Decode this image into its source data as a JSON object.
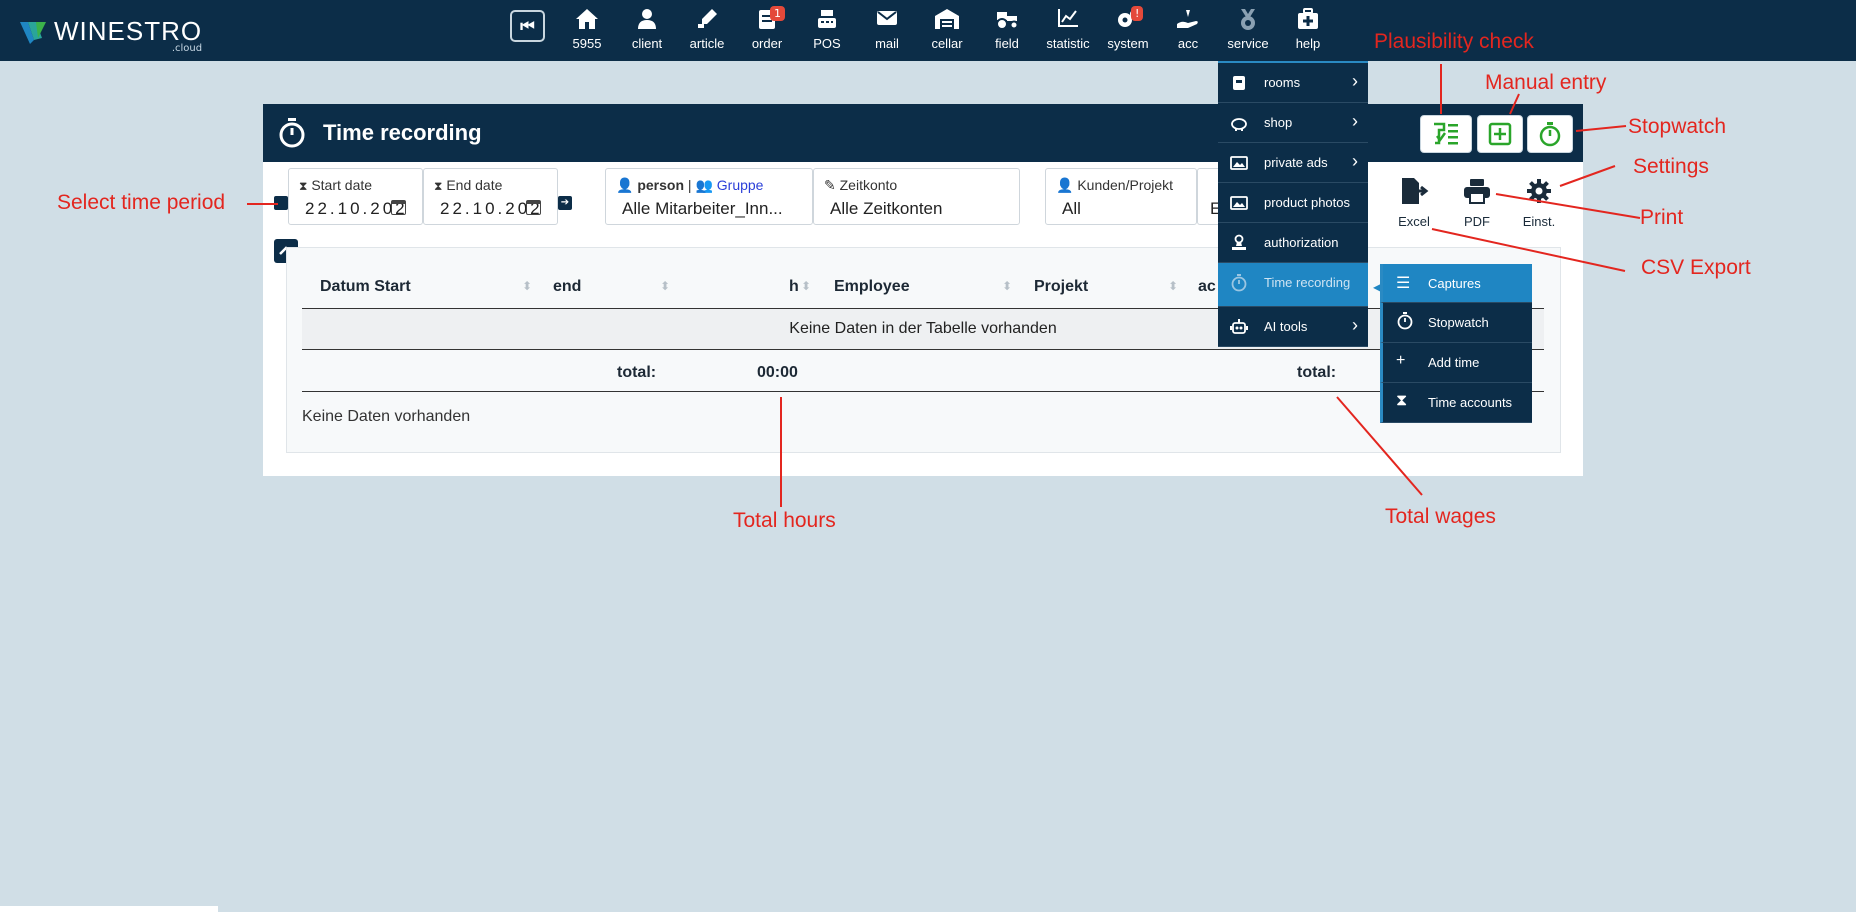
{
  "brand": {
    "name": "WINESTRO",
    "sub": ".cloud"
  },
  "nav": [
    {
      "label": "5955",
      "icon": "home-icon"
    },
    {
      "label": "client",
      "icon": "user-icon"
    },
    {
      "label": "article",
      "icon": "wine-icon"
    },
    {
      "label": "order",
      "icon": "order-icon",
      "badge": "1"
    },
    {
      "label": "POS",
      "icon": "register-icon"
    },
    {
      "label": "mail",
      "icon": "mail-icon"
    },
    {
      "label": "cellar",
      "icon": "warehouse-icon"
    },
    {
      "label": "field",
      "icon": "tractor-icon"
    },
    {
      "label": "statistic",
      "icon": "chart-icon"
    },
    {
      "label": "system",
      "icon": "gears-icon",
      "badge": "!"
    },
    {
      "label": "acc",
      "icon": "hand-coin-icon"
    },
    {
      "label": "service",
      "icon": "medal-icon"
    },
    {
      "label": "help",
      "icon": "first-aid-icon"
    }
  ],
  "panel": {
    "title": "Time recording",
    "start_label": "Start date",
    "start_value": "22.10.202",
    "end_label": "End date",
    "end_value": "22.10.202",
    "person_label": "person",
    "separator": "|",
    "group_label": "Gruppe",
    "person_value": "Alle Mitarbeiter_Inn...",
    "account_label": "Zeitkonto",
    "account_value": "Alle Zeitkonten",
    "client_label": "Kunden/Projekt",
    "client_value": "All",
    "extra_value": "E"
  },
  "tools": [
    {
      "label": "Excel"
    },
    {
      "label": "PDF"
    },
    {
      "label": "Einst."
    }
  ],
  "table": {
    "columns": [
      "Datum Start",
      "end",
      "h",
      "Employee",
      "Projekt",
      "ac"
    ],
    "empty_text": "Keine Daten in der Tabelle vorhanden",
    "total_label": "total:",
    "total_hours": "00:00",
    "total_label2": "total:",
    "no_data": "Keine Daten vorhanden"
  },
  "service_menu": [
    {
      "label": "rooms",
      "chevron": true
    },
    {
      "label": "shop",
      "chevron": true
    },
    {
      "label": "private ads",
      "chevron": true
    },
    {
      "label": "product photos",
      "chevron": false
    },
    {
      "label": "authorization",
      "chevron": false
    },
    {
      "label": "Time recording",
      "chevron": false,
      "active": true
    },
    {
      "label": "AI tools",
      "chevron": true
    }
  ],
  "submenu": [
    {
      "label": "Captures",
      "active": true
    },
    {
      "label": "Stopwatch"
    },
    {
      "label": "Add time"
    },
    {
      "label": "Time accounts"
    }
  ],
  "annotations": {
    "plausibility": "Plausibility check",
    "manual": "Manual entry",
    "stopwatch": "Stopwatch",
    "settings": "Settings",
    "print": "Print",
    "csv": "CSV Export",
    "period": "Select time period",
    "hours": "Total hours",
    "wages": "Total wages"
  },
  "colors": {
    "navy": "#0c2d48",
    "accent": "#1f86c3",
    "green": "#2aa52a",
    "annot": "#e3261f"
  }
}
